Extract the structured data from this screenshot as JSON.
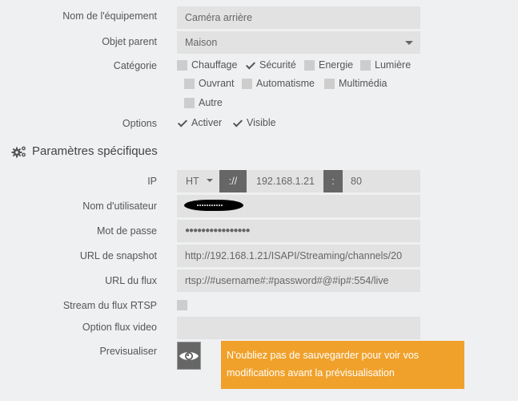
{
  "form": {
    "equipment_name": {
      "label": "Nom de l'équipement",
      "value": "Caméra arrière"
    },
    "parent_object": {
      "label": "Objet parent",
      "value": "Maison"
    },
    "category": {
      "label": "Catégorie",
      "options": [
        {
          "label": "Chauffage",
          "checked": false
        },
        {
          "label": "Sécurité",
          "checked": true
        },
        {
          "label": "Energie",
          "checked": false
        },
        {
          "label": "Lumière",
          "checked": false
        },
        {
          "label": "Ouvrant",
          "checked": false
        },
        {
          "label": "Automatisme",
          "checked": false
        },
        {
          "label": "Multimédia",
          "checked": false
        },
        {
          "label": "Autre",
          "checked": false
        }
      ]
    },
    "options": {
      "label": "Options",
      "items": [
        {
          "label": "Activer",
          "checked": true
        },
        {
          "label": "Visible",
          "checked": true
        }
      ]
    }
  },
  "specific": {
    "title": "Paramètres spécifiques",
    "icon": "gears-icon",
    "ip": {
      "label": "IP",
      "protocol": "HT",
      "separator1": "://",
      "address": "192.168.1.21",
      "separator2": ":",
      "port": "80"
    },
    "username": {
      "label": "Nom d'utilisateur",
      "value": "[redacted]"
    },
    "password": {
      "label": "Mot de passe",
      "value": "●●●●●●●●●●●●●●●●"
    },
    "snapshot_url": {
      "label": "URL de snapshot",
      "value": "http://192.168.1.21/ISAPI/Streaming/channels/20"
    },
    "stream_url": {
      "label": "URL du flux",
      "value": "rtsp://#username#:#password#@#ip#:554/live"
    },
    "rtsp_stream": {
      "label": "Stream du flux RTSP",
      "checked": false
    },
    "video_option": {
      "label": "Option flux video",
      "value": ""
    },
    "preview": {
      "label": "Previsualiser",
      "icon": "eye-icon",
      "alert": "N'oubliez pas de sauvegarder pour voir vos modifications avant la prévisualisation"
    }
  },
  "colors": {
    "alert_bg": "#f0a12b",
    "field_bg": "#e1e2e1",
    "button_bg": "#666666"
  }
}
